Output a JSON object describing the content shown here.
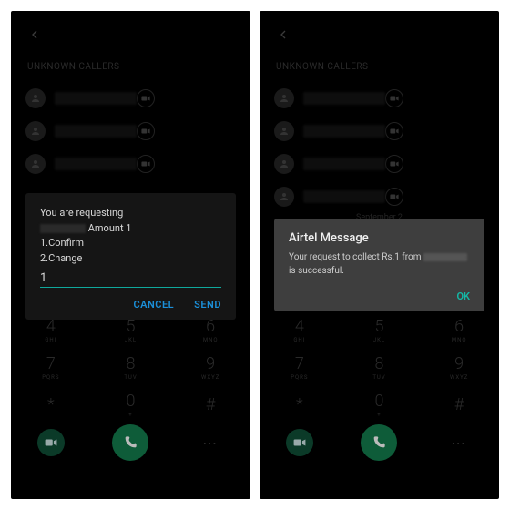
{
  "left": {
    "section_header": "UNKNOWN CALLERS",
    "dialog": {
      "line1": "You are requesting",
      "line2_suffix": "Amount 1",
      "opt1": "1.Confirm",
      "opt2": "2.Change",
      "input_value": "1",
      "cancel": "CANCEL",
      "send": "SEND"
    }
  },
  "right": {
    "section_header": "UNKNOWN CALLERS",
    "date_divider": "September 2",
    "dialog": {
      "title": "Airtel Message",
      "body_prefix": "Your request to collect Rs.1 from ",
      "body_suffix": "is successful.",
      "ok": "OK"
    }
  },
  "keypad": {
    "keys": [
      {
        "n": "4",
        "s": "GHI"
      },
      {
        "n": "5",
        "s": "JKL"
      },
      {
        "n": "6",
        "s": "MNO"
      },
      {
        "n": "7",
        "s": "PQRS"
      },
      {
        "n": "8",
        "s": "TUV"
      },
      {
        "n": "9",
        "s": "WXYZ"
      },
      {
        "n": "*",
        "s": ""
      },
      {
        "n": "0",
        "s": "+"
      },
      {
        "n": "#",
        "s": ""
      }
    ]
  }
}
